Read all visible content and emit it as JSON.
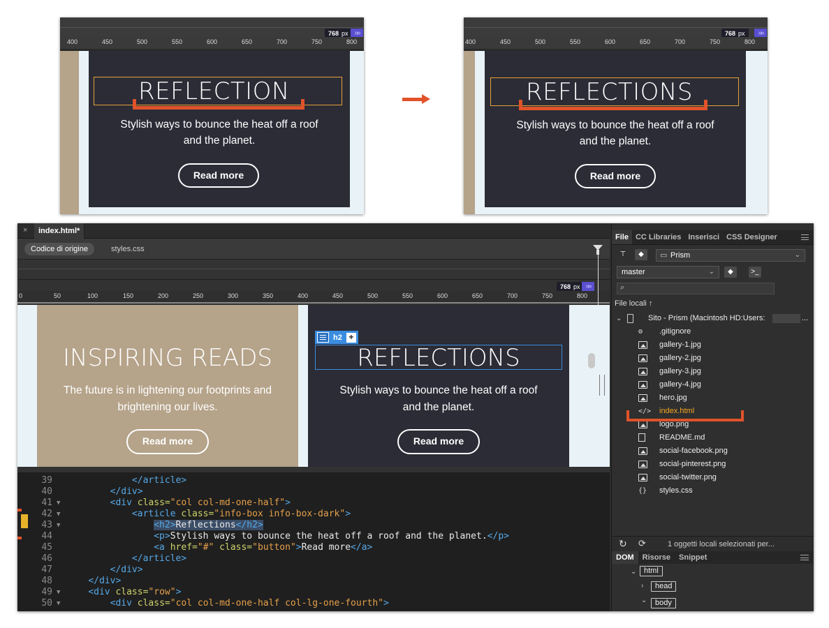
{
  "before": {
    "viewport_width": "768",
    "unit": "px",
    "ruler_ticks": [
      "400",
      "450",
      "500",
      "550",
      "600",
      "650",
      "700",
      "750",
      "800"
    ],
    "title": "REFLECTION",
    "subtitle_line1": "Stylish ways to bounce the heat off a roof",
    "subtitle_line2": "and the planet.",
    "button": "Read more"
  },
  "after": {
    "viewport_width": "768",
    "unit": "px",
    "ruler_ticks": [
      "400",
      "450",
      "500",
      "550",
      "600",
      "650",
      "700",
      "750",
      "800"
    ],
    "title": "REFLECTIONS",
    "subtitle_line1": "Stylish ways to bounce the heat off a roof",
    "subtitle_line2": "and the planet.",
    "button": "Read more"
  },
  "editor": {
    "tab_close": "×",
    "doc_tab": "index.html*",
    "source_pill": "Codice di origine",
    "related_file": "styles.css",
    "viewport_width": "768",
    "unit": "px",
    "ruler_ticks": [
      "0",
      "50",
      "100",
      "150",
      "200",
      "250",
      "300",
      "350",
      "400",
      "450",
      "500",
      "550",
      "600",
      "650",
      "700",
      "750",
      "800"
    ],
    "left_title": "INSPIRING READS",
    "left_sub1": "The future is in lightening our footprints and",
    "left_sub2": "brightening our lives.",
    "left_button": "Read more",
    "right_title": "REFLECTIONS",
    "right_sub1": "Stylish ways to bounce the heat off a roof",
    "right_sub2": "and the planet.",
    "right_button": "Read more",
    "element_tag": "h2",
    "element_add": "+"
  },
  "code": {
    "lines": [
      {
        "n": "39",
        "fold": ""
      },
      {
        "n": "40",
        "fold": ""
      },
      {
        "n": "41",
        "fold": "▼"
      },
      {
        "n": "42",
        "fold": "▼"
      },
      {
        "n": "43",
        "fold": "▼"
      },
      {
        "n": "44",
        "fold": ""
      },
      {
        "n": "45",
        "fold": ""
      },
      {
        "n": "46",
        "fold": ""
      },
      {
        "n": "47",
        "fold": ""
      },
      {
        "n": "48",
        "fold": ""
      },
      {
        "n": "49",
        "fold": "▼"
      },
      {
        "n": "50",
        "fold": "▼"
      }
    ],
    "h2_text": "Reflections",
    "p_text": "Stylish ways to bounce the heat off a roof and the planet.",
    "a_text": "Read more",
    "class_col": "col col-md-one-half",
    "class_article": "info-box info-box-dark",
    "class_row": "row",
    "class_col2": "col col-md-one-half col-lg-one-fourth",
    "href": "#",
    "class_button": "button"
  },
  "panel": {
    "tabs": [
      "File",
      "CC Libraries",
      "Inserisci",
      "CSS Designer"
    ],
    "site_select": "Prism",
    "branch_select": "master",
    "search_placeholder": "",
    "section_label": "File locali ↑",
    "site_root": "Sito - Prism (Macintosh HD:Users:",
    "site_root_suffix": "...",
    "files": [
      {
        "name": ".gitignore",
        "icon": "gear-doc-icon"
      },
      {
        "name": "gallery-1.jpg",
        "icon": "image-icon"
      },
      {
        "name": "gallery-2.jpg",
        "icon": "image-icon"
      },
      {
        "name": "gallery-3.jpg",
        "icon": "image-icon"
      },
      {
        "name": "gallery-4.jpg",
        "icon": "image-icon"
      },
      {
        "name": "hero.jpg",
        "icon": "image-icon"
      },
      {
        "name": "index.html",
        "icon": "code-icon"
      },
      {
        "name": "logo.png",
        "icon": "image-icon"
      },
      {
        "name": "README.md",
        "icon": "document-icon"
      },
      {
        "name": "social-facebook.png",
        "icon": "image-icon"
      },
      {
        "name": "social-pinterest.png",
        "icon": "image-icon"
      },
      {
        "name": "social-twitter.png",
        "icon": "image-icon"
      },
      {
        "name": "styles.css",
        "icon": "css-icon"
      }
    ],
    "status": "1 oggetti locali selezionati per...",
    "dom_tabs": [
      "DOM",
      "Risorse",
      "Snippet"
    ],
    "dom_nodes": [
      "html",
      "head",
      "body"
    ]
  },
  "colors": {
    "accent_orange": "#e0532a",
    "selection_blue": "#3b8de0",
    "dark_box": "#2b2c36",
    "beige_box": "#b5a38a"
  }
}
